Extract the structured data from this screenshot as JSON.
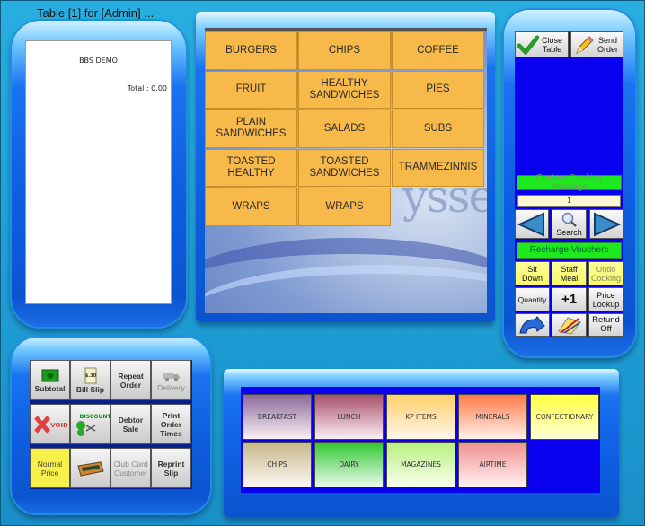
{
  "window": {
    "title": "Table [1] for [Admin] ..."
  },
  "receipt": {
    "shop_name": "BBS DEMO",
    "total_text": "Total : 0.00"
  },
  "background": {
    "brand_fragment": "ysse"
  },
  "menu_categories": [
    "BURGERS",
    "CHIPS",
    "COFFEE",
    "FRUIT",
    "HEALTHY\nSANDWICHES",
    "PIES",
    "PLAIN\nSANDWICHES",
    "SALADS",
    "SUBS",
    "TOASTED\nHEALTHY",
    "TOASTED\nSANDWICHES",
    "TRAMMEZINNIS",
    "WRAPS",
    "WRAPS"
  ],
  "right_panel": {
    "close_table": "Close\nTable",
    "send_order": "Send\nOrder",
    "custom_cooking_message": "Custom Cooking Message",
    "counter_value": "1",
    "search": "Search",
    "recharge_vouchers": "Recharge Vouchers",
    "sit_down": "Sit\nDown",
    "staff_meal": "Staff\nMeal",
    "undo_cooking": "Undo\nCooking",
    "quantity": "Quantity",
    "plus_one": "+1",
    "price_lookup": "Price\nLookup",
    "refund_off": "Refund\nOff"
  },
  "function_pad": {
    "subtotal": "Subtotal",
    "bill_slip": "Bill Slip",
    "bill_slip_icon_text": "$.30",
    "repeat_order": "Repeat\nOrder",
    "delivery": "Delivery",
    "void_icon_text": "VOID",
    "discount_icon_text": "DISCOUNT",
    "debtor_sale": "Debtor\nSale",
    "print_order_times": "Print\nOrder\nTimes",
    "normal_price": "Normal\nPrice",
    "club_card_customer": "Club Card\nCustomer",
    "reprint_slip": "Reprint\nSlip"
  },
  "departments": [
    {
      "label": "BREAKFAST",
      "top": "#8a6a98",
      "bottom": "#fbf0f8"
    },
    {
      "label": "LUNCH",
      "top": "#a8506c",
      "bottom": "#fbeef4"
    },
    {
      "label": "KP ITEMS",
      "top": "#ffcf6a",
      "bottom": "#fff6ea"
    },
    {
      "label": "MINERALS",
      "top": "#ff7a48",
      "bottom": "#fff0ea"
    },
    {
      "label": "CONFECTIONARY",
      "top": "#ffff40",
      "bottom": "#ffffd8"
    },
    {
      "label": "CHIPS",
      "top": "#c8b888",
      "bottom": "#fbf6f2"
    },
    {
      "label": "DAIRY",
      "top": "#30c830",
      "bottom": "#eaf8ea"
    },
    {
      "label": "MAGAZINES",
      "top": "#b8f080",
      "bottom": "#f8ffec"
    },
    {
      "label": "AIRTIME",
      "top": "#f09090",
      "bottom": "#fff0f0"
    }
  ]
}
